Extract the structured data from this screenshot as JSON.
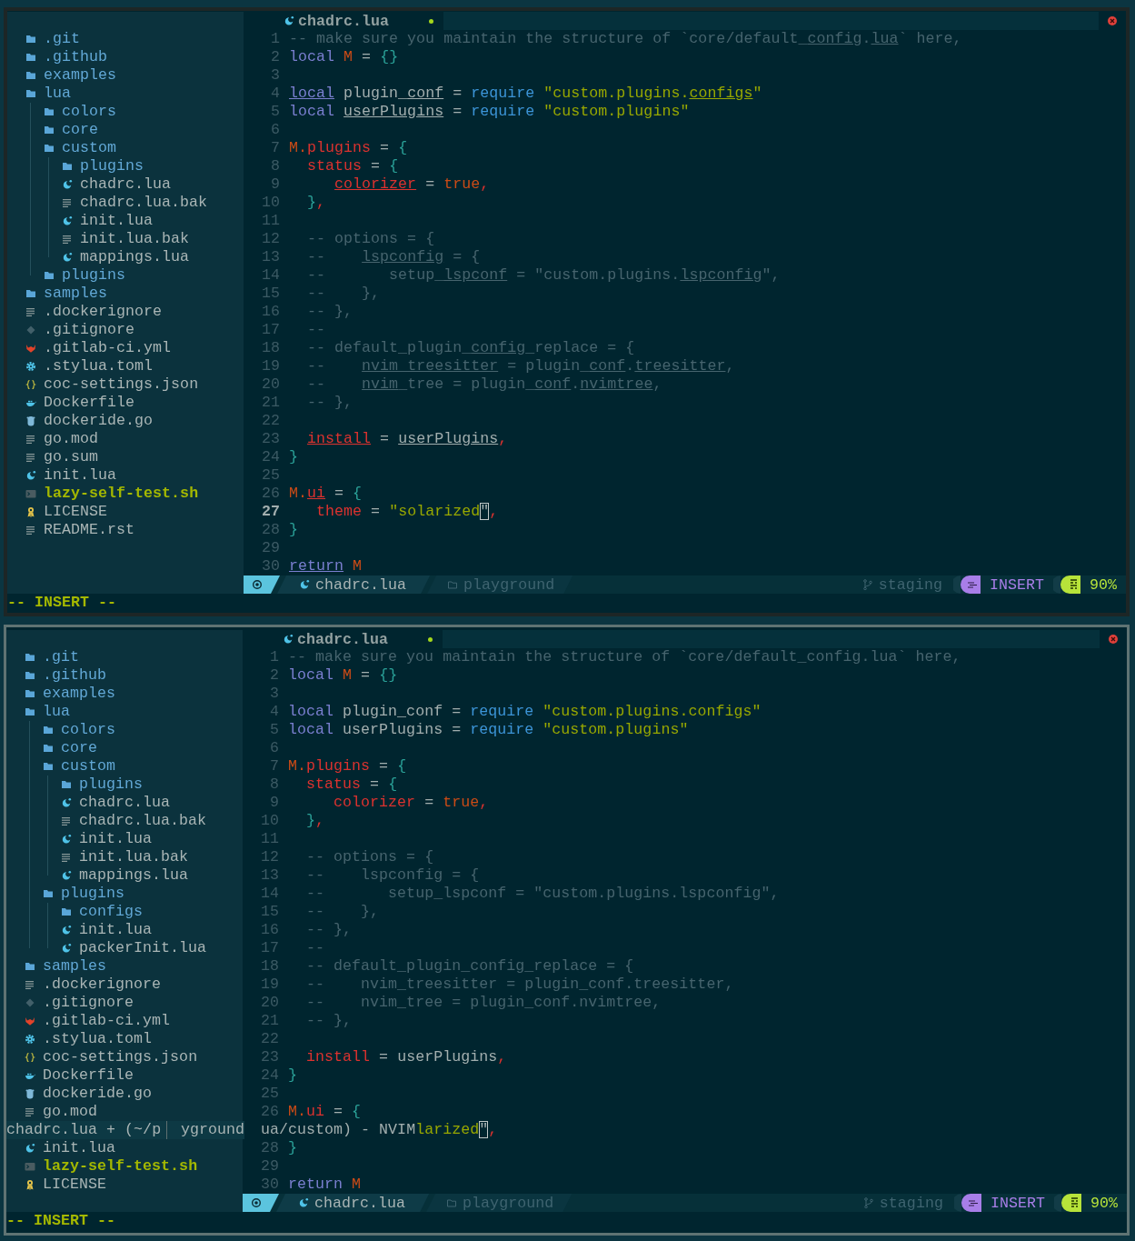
{
  "windows": [
    {
      "focused": false,
      "sidebar": {
        "items": [
          {
            "label": ".git",
            "kind": "folder"
          },
          {
            "label": ".github",
            "kind": "folder"
          },
          {
            "label": "examples",
            "kind": "folder"
          },
          {
            "label": "lua",
            "kind": "folder",
            "children": [
              {
                "label": "colors",
                "kind": "folder"
              },
              {
                "label": "core",
                "kind": "folder"
              },
              {
                "label": "custom",
                "kind": "folder",
                "children": [
                  {
                    "label": "plugins",
                    "kind": "folder"
                  },
                  {
                    "label": "chadrc.lua",
                    "kind": "lua"
                  },
                  {
                    "label": "chadrc.lua.bak",
                    "kind": "text"
                  },
                  {
                    "label": "init.lua",
                    "kind": "lua"
                  },
                  {
                    "label": "init.lua.bak",
                    "kind": "text"
                  },
                  {
                    "label": "mappings.lua",
                    "kind": "lua"
                  }
                ]
              },
              {
                "label": "plugins",
                "kind": "folder"
              }
            ]
          },
          {
            "label": "samples",
            "kind": "folder"
          },
          {
            "label": ".dockerignore",
            "kind": "text"
          },
          {
            "label": ".gitignore",
            "kind": "git"
          },
          {
            "label": ".gitlab-ci.yml",
            "kind": "gitlab"
          },
          {
            "label": ".stylua.toml",
            "kind": "config"
          },
          {
            "label": "coc-settings.json",
            "kind": "json"
          },
          {
            "label": "Dockerfile",
            "kind": "docker"
          },
          {
            "label": "dockeride.go",
            "kind": "go"
          },
          {
            "label": "go.mod",
            "kind": "text"
          },
          {
            "label": "go.sum",
            "kind": "text"
          },
          {
            "label": "init.lua",
            "kind": "lua"
          },
          {
            "label": "lazy-self-test.sh",
            "kind": "shell"
          },
          {
            "label": "LICENSE",
            "kind": "license"
          },
          {
            "label": "README.rst",
            "kind": "text"
          }
        ]
      },
      "tab": {
        "label": "chadrc.lua",
        "modified": true
      },
      "lines": [
        {
          "number": "1",
          "tokens": [
            {
              "text": "-- make sure you maintain the structure of `core/default_",
              "kind": "comment",
              "underlined": false
            },
            {
              "text": "config",
              "kind": "comment",
              "underlined": true
            },
            {
              "text": ".",
              "kind": "comment",
              "underlined": false
            },
            {
              "text": "lua",
              "kind": "comment",
              "underlined": true
            },
            {
              "text": "` here,",
              "kind": "comment",
              "underlined": false
            }
          ]
        },
        {
          "number": "2",
          "tokens": [
            {
              "text": "local",
              "kind": "keyword",
              "underlined": false
            },
            {
              "text": " M",
              "kind": "var",
              "underlined": false
            },
            {
              "text": " = ",
              "kind": "op",
              "underlined": false
            },
            {
              "text": "{}",
              "kind": "brace",
              "underlined": false
            }
          ]
        },
        {
          "number": "3"
        },
        {
          "number": "4",
          "tokens": [
            {
              "text": "local",
              "kind": "keyword",
              "underlined": true
            },
            {
              "text": " plugin_",
              "kind": "plain",
              "underlined": false
            },
            {
              "text": "conf",
              "kind": "plain",
              "underlined": true
            },
            {
              "text": " = ",
              "kind": "op",
              "underlined": false
            },
            {
              "text": "require",
              "kind": "func",
              "underlined": false
            },
            {
              "text": " \"custom.plugins.",
              "kind": "string",
              "underlined": false
            },
            {
              "text": "configs",
              "kind": "string",
              "underlined": true
            },
            {
              "text": "\"",
              "kind": "string",
              "underlined": false
            }
          ]
        },
        {
          "number": "5",
          "tokens": [
            {
              "text": "local",
              "kind": "keyword",
              "underlined": false
            },
            {
              "text": " userPlugins",
              "kind": "plain",
              "underlined": true
            },
            {
              "text": " = ",
              "kind": "op",
              "underlined": false
            },
            {
              "text": "require",
              "kind": "func",
              "underlined": false
            },
            {
              "text": " \"custom.plugins\"",
              "kind": "string",
              "underlined": false
            }
          ]
        },
        {
          "number": "6"
        },
        {
          "number": "7",
          "tokens": [
            {
              "text": "M.",
              "kind": "var",
              "underlined": false
            },
            {
              "text": "plugins",
              "kind": "field",
              "underlined": false
            },
            {
              "text": " = ",
              "kind": "op",
              "underlined": false
            },
            {
              "text": "{",
              "kind": "brace",
              "underlined": false
            }
          ]
        },
        {
          "number": "8",
          "tokens": [
            {
              "text": "  status",
              "kind": "field",
              "underlined": false
            },
            {
              "text": " = ",
              "kind": "op",
              "underlined": false
            },
            {
              "text": "{",
              "kind": "brace",
              "underlined": false
            }
          ]
        },
        {
          "number": "9",
          "tokens": [
            {
              "text": "     colorizer",
              "kind": "field",
              "underlined": true
            },
            {
              "text": " = ",
              "kind": "op",
              "underlined": false
            },
            {
              "text": "true",
              "kind": "bool",
              "underlined": false
            },
            {
              "text": ",",
              "kind": "punct",
              "underlined": false
            }
          ]
        },
        {
          "number": "10",
          "tokens": [
            {
              "text": "  }",
              "kind": "brace",
              "underlined": false
            },
            {
              "text": ",",
              "kind": "punct",
              "underlined": false
            }
          ]
        },
        {
          "number": "11"
        },
        {
          "number": "12",
          "tokens": [
            {
              "text": "  -- options = {",
              "kind": "comment",
              "underlined": false
            }
          ]
        },
        {
          "number": "13",
          "tokens": [
            {
              "text": "  --    ",
              "kind": "comment",
              "underlined": false
            },
            {
              "text": "lspconfig",
              "kind": "comment",
              "underlined": true
            },
            {
              "text": " = {",
              "kind": "comment",
              "underlined": false
            }
          ]
        },
        {
          "number": "14",
          "tokens": [
            {
              "text": "  --       setup_",
              "kind": "comment",
              "underlined": false
            },
            {
              "text": "lspconf",
              "kind": "comment",
              "underlined": true
            },
            {
              "text": " = \"custom.plugins.",
              "kind": "comment",
              "underlined": false
            },
            {
              "text": "lspconfig",
              "kind": "comment",
              "underlined": true
            },
            {
              "text": "\",",
              "kind": "comment",
              "underlined": false
            }
          ]
        },
        {
          "number": "15",
          "tokens": [
            {
              "text": "  --    },",
              "kind": "comment",
              "underlined": false
            }
          ]
        },
        {
          "number": "16",
          "tokens": [
            {
              "text": "  -- },",
              "kind": "comment",
              "underlined": false
            }
          ]
        },
        {
          "number": "17",
          "tokens": [
            {
              "text": "  --",
              "kind": "comment",
              "underlined": false
            }
          ]
        },
        {
          "number": "18",
          "tokens": [
            {
              "text": "  -- default_plugin_",
              "kind": "comment",
              "underlined": false
            },
            {
              "text": "config",
              "kind": "comment",
              "underlined": true
            },
            {
              "text": "_replace = {",
              "kind": "comment",
              "underlined": false
            }
          ]
        },
        {
          "number": "19",
          "tokens": [
            {
              "text": "  --    ",
              "kind": "comment",
              "underlined": false
            },
            {
              "text": "nvim_treesitter",
              "kind": "comment",
              "underlined": true
            },
            {
              "text": " = plugin_",
              "kind": "comment",
              "underlined": false
            },
            {
              "text": "conf",
              "kind": "comment",
              "underlined": true
            },
            {
              "text": ".",
              "kind": "comment",
              "underlined": false
            },
            {
              "text": "treesitter",
              "kind": "comment",
              "underlined": true
            },
            {
              "text": ",",
              "kind": "comment",
              "underlined": false
            }
          ]
        },
        {
          "number": "20",
          "tokens": [
            {
              "text": "  --    ",
              "kind": "comment",
              "underlined": false
            },
            {
              "text": "nvim",
              "kind": "comment",
              "underlined": true
            },
            {
              "text": "_tree = plugin_",
              "kind": "comment",
              "underlined": false
            },
            {
              "text": "conf",
              "kind": "comment",
              "underlined": true
            },
            {
              "text": ".",
              "kind": "comment",
              "underlined": false
            },
            {
              "text": "nvimtree",
              "kind": "comment",
              "underlined": true
            },
            {
              "text": ",",
              "kind": "comment",
              "underlined": false
            }
          ]
        },
        {
          "number": "21",
          "tokens": [
            {
              "text": "  -- },",
              "kind": "comment",
              "underlined": false
            }
          ]
        },
        {
          "number": "22"
        },
        {
          "number": "23",
          "tokens": [
            {
              "text": "  install",
              "kind": "field",
              "underlined": true
            },
            {
              "text": " = ",
              "kind": "op",
              "underlined": false
            },
            {
              "text": "userPlugins",
              "kind": "plain",
              "underlined": true
            },
            {
              "text": ",",
              "kind": "punct",
              "underlined": false
            }
          ]
        },
        {
          "number": "24",
          "tokens": [
            {
              "text": "}",
              "kind": "brace",
              "underlined": false
            }
          ]
        },
        {
          "number": "25"
        },
        {
          "number": "26",
          "tokens": [
            {
              "text": "M.",
              "kind": "var",
              "underlined": false
            },
            {
              "text": "ui",
              "kind": "field",
              "underlined": true
            },
            {
              "text": " = ",
              "kind": "op",
              "underlined": false
            },
            {
              "text": "{",
              "kind": "brace",
              "underlined": false
            }
          ]
        },
        {
          "number": "27",
          "tokens": [
            {
              "text": "   theme",
              "kind": "field",
              "underlined": false
            },
            {
              "text": " = ",
              "kind": "op",
              "underlined": false
            },
            {
              "text": "\"solarized",
              "kind": "string",
              "underlined": false
            },
            {
              "text": "\"",
              "kind": "cursor",
              "underlined": false
            },
            {
              "text": ",",
              "kind": "punct",
              "underlined": false
            }
          ]
        },
        {
          "number": "28",
          "tokens": [
            {
              "text": "}",
              "kind": "brace",
              "underlined": false
            }
          ]
        },
        {
          "number": "29"
        },
        {
          "number": "30",
          "tokens": [
            {
              "text": "return",
              "kind": "keyword",
              "underlined": true
            },
            {
              "text": " M",
              "kind": "var",
              "underlined": false
            }
          ]
        }
      ],
      "statusline": {
        "file": "chadrc.lua",
        "directory": "playground",
        "branch": "staging",
        "mode": "INSERT",
        "progress": "90%"
      },
      "cmdline": "-- INSERT --"
    },
    {
      "focused": true,
      "sidebar": {
        "items": [
          {
            "label": ".git",
            "kind": "folder"
          },
          {
            "label": ".github",
            "kind": "folder"
          },
          {
            "label": "examples",
            "kind": "folder"
          },
          {
            "label": "lua",
            "kind": "folder",
            "children": [
              {
                "label": "colors",
                "kind": "folder"
              },
              {
                "label": "core",
                "kind": "folder"
              },
              {
                "label": "custom",
                "kind": "folder",
                "children": [
                  {
                    "label": "plugins",
                    "kind": "folder"
                  },
                  {
                    "label": "chadrc.lua",
                    "kind": "lua"
                  },
                  {
                    "label": "chadrc.lua.bak",
                    "kind": "text"
                  },
                  {
                    "label": "init.lua",
                    "kind": "lua"
                  },
                  {
                    "label": "init.lua.bak",
                    "kind": "text"
                  },
                  {
                    "label": "mappings.lua",
                    "kind": "lua"
                  }
                ]
              },
              {
                "label": "plugins",
                "kind": "folder",
                "children": [
                  {
                    "label": "configs",
                    "kind": "folder"
                  },
                  {
                    "label": "init.lua",
                    "kind": "lua"
                  },
                  {
                    "label": "packerInit.lua",
                    "kind": "lua"
                  }
                ]
              }
            ]
          },
          {
            "label": "samples",
            "kind": "folder"
          },
          {
            "label": ".dockerignore",
            "kind": "text"
          },
          {
            "label": ".gitignore",
            "kind": "git"
          },
          {
            "label": ".gitlab-ci.yml",
            "kind": "gitlab"
          },
          {
            "label": ".stylua.toml",
            "kind": "config"
          },
          {
            "label": "coc-settings.json",
            "kind": "json"
          },
          {
            "label": "Dockerfile",
            "kind": "docker"
          },
          {
            "label": "dockeride.go",
            "kind": "go"
          },
          {
            "label": "go.mod",
            "kind": "text"
          },
          {
            "kind": "overlay",
            "texts": [
              "chadrc.lua + (~/p",
              "yground"
            ]
          },
          {
            "label": "init.lua",
            "kind": "lua"
          },
          {
            "label": "lazy-self-test.sh",
            "kind": "shell"
          },
          {
            "label": "LICENSE",
            "kind": "license"
          }
        ]
      },
      "tab": {
        "label": "chadrc.lua",
        "modified": true
      },
      "lines": [
        {
          "number": "1",
          "tokens": [
            {
              "text": "-- make sure you maintain the structure of `core/default_config.lua` here,",
              "kind": "comment"
            }
          ]
        },
        {
          "number": "2",
          "tokens": [
            {
              "text": "local",
              "kind": "keyword"
            },
            {
              "text": " M",
              "kind": "var"
            },
            {
              "text": " = ",
              "kind": "op"
            },
            {
              "text": "{}",
              "kind": "brace"
            }
          ]
        },
        {
          "number": "3"
        },
        {
          "number": "4",
          "tokens": [
            {
              "text": "local",
              "kind": "keyword"
            },
            {
              "text": " plugin_conf",
              "kind": "plain"
            },
            {
              "text": " = ",
              "kind": "op"
            },
            {
              "text": "require",
              "kind": "func"
            },
            {
              "text": " \"custom.plugins.configs\"",
              "kind": "string"
            }
          ]
        },
        {
          "number": "5",
          "tokens": [
            {
              "text": "local",
              "kind": "keyword"
            },
            {
              "text": " userPlugins",
              "kind": "plain"
            },
            {
              "text": " = ",
              "kind": "op"
            },
            {
              "text": "require",
              "kind": "func"
            },
            {
              "text": " \"custom.plugins\"",
              "kind": "string"
            }
          ]
        },
        {
          "number": "6"
        },
        {
          "number": "7",
          "tokens": [
            {
              "text": "M.",
              "kind": "var"
            },
            {
              "text": "plugins",
              "kind": "field"
            },
            {
              "text": " = ",
              "kind": "op"
            },
            {
              "text": "{",
              "kind": "brace"
            }
          ]
        },
        {
          "number": "8",
          "tokens": [
            {
              "text": "  status",
              "kind": "field"
            },
            {
              "text": " = ",
              "kind": "op"
            },
            {
              "text": "{",
              "kind": "brace"
            }
          ]
        },
        {
          "number": "9",
          "tokens": [
            {
              "text": "     colorizer",
              "kind": "field"
            },
            {
              "text": " = ",
              "kind": "op"
            },
            {
              "text": "true",
              "kind": "bool"
            },
            {
              "text": ",",
              "kind": "punct"
            }
          ]
        },
        {
          "number": "10",
          "tokens": [
            {
              "text": "  }",
              "kind": "brace"
            },
            {
              "text": ",",
              "kind": "punct"
            }
          ]
        },
        {
          "number": "11"
        },
        {
          "number": "12",
          "tokens": [
            {
              "text": "  -- options = {",
              "kind": "comment"
            }
          ]
        },
        {
          "number": "13",
          "tokens": [
            {
              "text": "  --    lspconfig = {",
              "kind": "comment"
            }
          ]
        },
        {
          "number": "14",
          "tokens": [
            {
              "text": "  --       setup_lspconf = \"custom.plugins.lspconfig\",",
              "kind": "comment"
            }
          ]
        },
        {
          "number": "15",
          "tokens": [
            {
              "text": "  --    },",
              "kind": "comment"
            }
          ]
        },
        {
          "number": "16",
          "tokens": [
            {
              "text": "  -- },",
              "kind": "comment"
            }
          ]
        },
        {
          "number": "17",
          "tokens": [
            {
              "text": "  --",
              "kind": "comment"
            }
          ]
        },
        {
          "number": "18",
          "tokens": [
            {
              "text": "  -- default_plugin_config_replace = {",
              "kind": "comment"
            }
          ]
        },
        {
          "number": "19",
          "tokens": [
            {
              "text": "  --    nvim_treesitter = plugin_conf.treesitter,",
              "kind": "comment"
            }
          ]
        },
        {
          "number": "20",
          "tokens": [
            {
              "text": "  --    nvim_tree = plugin_conf.nvimtree,",
              "kind": "comment"
            }
          ]
        },
        {
          "number": "21",
          "tokens": [
            {
              "text": "  -- },",
              "kind": "comment"
            }
          ]
        },
        {
          "number": "22"
        },
        {
          "number": "23",
          "tokens": [
            {
              "text": "  install",
              "kind": "field"
            },
            {
              "text": " = ",
              "kind": "op"
            },
            {
              "text": "userPlugins",
              "kind": "plain"
            },
            {
              "text": ",",
              "kind": "punct"
            }
          ]
        },
        {
          "number": "24",
          "tokens": [
            {
              "text": "}",
              "kind": "brace"
            }
          ]
        },
        {
          "number": "25"
        },
        {
          "number": "26",
          "tokens": [
            {
              "text": "M.",
              "kind": "var"
            },
            {
              "text": "ui",
              "kind": "field"
            },
            {
              "text": " = ",
              "kind": "op"
            },
            {
              "text": "{",
              "kind": "brace"
            }
          ]
        },
        {
          "tokens": [
            {
              "text": "ua/custom) - NVIM",
              "kind": "plain"
            },
            {
              "text": "larized",
              "kind": "string"
            },
            {
              "text": "\"",
              "kind": "cursor"
            },
            {
              "text": ",",
              "kind": "punct"
            }
          ]
        },
        {
          "number": "28",
          "tokens": [
            {
              "text": "}",
              "kind": "brace"
            }
          ]
        },
        {
          "number": "29"
        },
        {
          "number": "30",
          "tokens": [
            {
              "text": "return",
              "kind": "keyword"
            },
            {
              "text": " M",
              "kind": "var"
            }
          ]
        }
      ],
      "statusline": {
        "file": "chadrc.lua",
        "directory": "playground",
        "branch": "staging",
        "mode": "INSERT",
        "progress": "90%"
      },
      "cmdline": "-- INSERT --"
    }
  ]
}
